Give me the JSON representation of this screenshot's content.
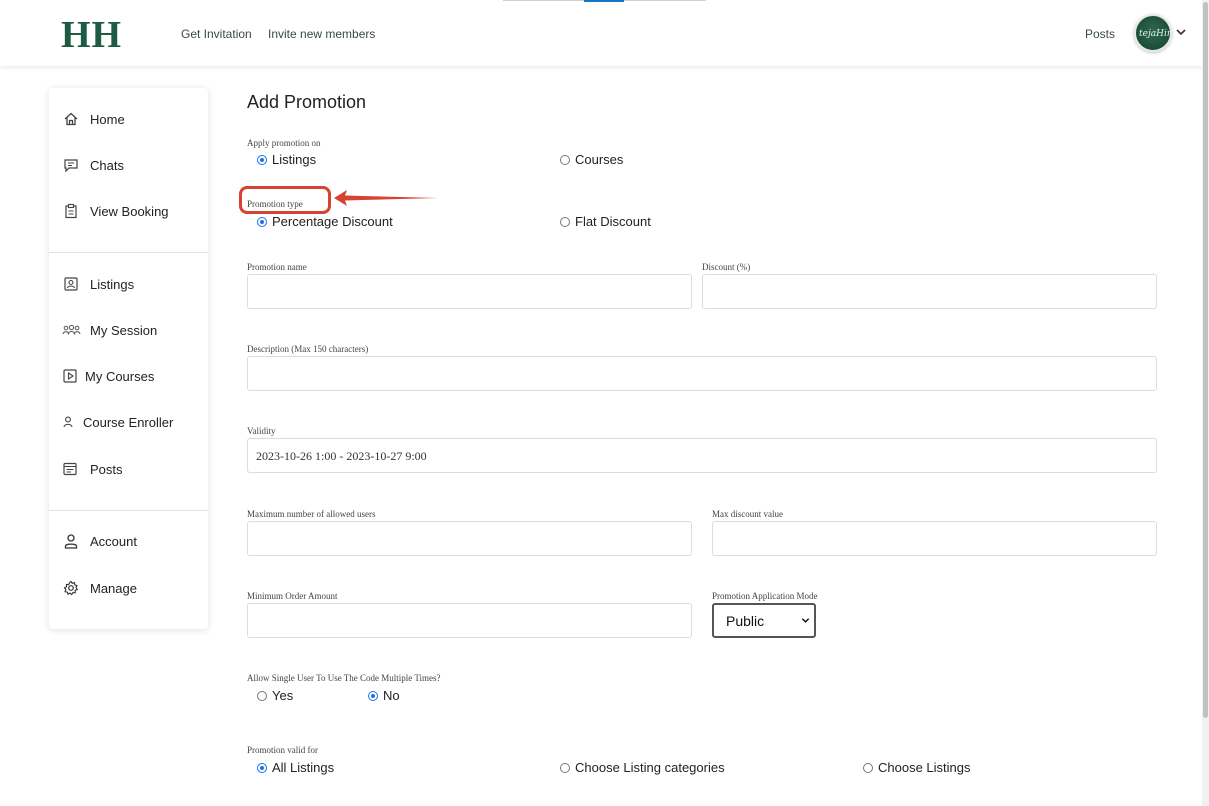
{
  "header": {
    "logo": "HH",
    "nav_links": [
      "Get Invitation",
      "Invite new members"
    ],
    "posts_link": "Posts",
    "avatar_label": "tejaHir"
  },
  "sidebar": {
    "items": [
      {
        "label": "Home",
        "icon": "home-icon"
      },
      {
        "label": "Chats",
        "icon": "chat-icon"
      },
      {
        "label": "View Booking",
        "icon": "clipboard-icon"
      },
      {
        "label": "Listings",
        "icon": "listing-icon"
      },
      {
        "label": "My Session",
        "icon": "group-icon"
      },
      {
        "label": "My Courses",
        "icon": "play-square-icon"
      },
      {
        "label": "Course Enroller",
        "icon": "user-icon"
      },
      {
        "label": "Posts",
        "icon": "posts-icon"
      },
      {
        "label": "Account",
        "icon": "account-icon"
      },
      {
        "label": "Manage",
        "icon": "gear-icon"
      }
    ]
  },
  "form": {
    "title": "Add Promotion",
    "apply_on": {
      "label": "Apply promotion on",
      "options": [
        "Listings",
        "Courses"
      ],
      "selected": "Listings"
    },
    "promotion_type": {
      "label": "Promotion type",
      "options": [
        "Percentage Discount",
        "Flat Discount"
      ],
      "selected": "Percentage Discount"
    },
    "promotion_name": {
      "label": "Promotion name",
      "value": ""
    },
    "discount": {
      "label": "Discount (%)",
      "value": ""
    },
    "description": {
      "label": "Description (Max 150 characters)",
      "value": ""
    },
    "validity": {
      "label": "Validity",
      "value": "2023-10-26 1:00 - 2023-10-27 9:00"
    },
    "max_users": {
      "label": "Maximum number of allowed users",
      "value": ""
    },
    "max_discount": {
      "label": "Max discount value",
      "value": ""
    },
    "min_order": {
      "label": "Minimum Order Amount",
      "value": ""
    },
    "application_mode": {
      "label": "Promotion Application Mode",
      "selected": "Public"
    },
    "multi_use": {
      "label": "Allow Single User To Use The Code Multiple Times?",
      "options": [
        "Yes",
        "No"
      ],
      "selected": "No"
    },
    "valid_for": {
      "label": "Promotion valid for",
      "options": [
        "All Listings",
        "Choose Listing categories",
        "Choose Listings"
      ],
      "selected": "All Listings"
    }
  },
  "colors": {
    "brand": "#1d5b43",
    "accent": "#1a73e8",
    "annotation": "#d64333"
  }
}
